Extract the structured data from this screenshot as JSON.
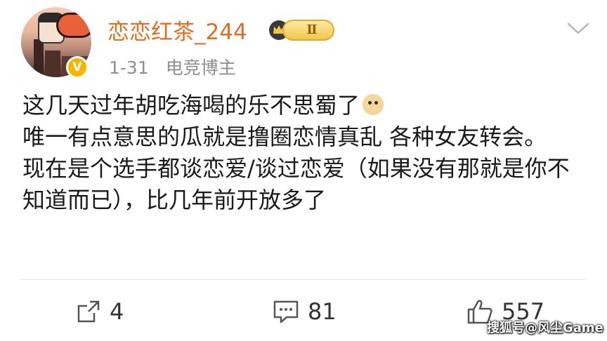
{
  "header": {
    "username": "恋恋红茶_244",
    "level_badge": "Ⅱ",
    "verified_badge": "V",
    "timestamp": "1-31",
    "tag": "电竞博主"
  },
  "post": {
    "line1": "这几天过年胡吃海喝的乐不思蜀了",
    "line2": "唯一有点意思的瓜就是撸圈恋情真乱 各种女友转会。",
    "line3": "现在是个选手都谈恋爱/谈过恋爱（如果没有那就是你不知道而已），比几年前开放多了",
    "emoji": "doge-emoji"
  },
  "actions": {
    "repost_count": "4",
    "comment_count": "81",
    "like_count": "557"
  },
  "watermark": "搜狐号@风尘Game",
  "colors": {
    "username": "#e06d21",
    "meta_text": "#8f8f8f",
    "badge_gold": "#f7b500"
  }
}
